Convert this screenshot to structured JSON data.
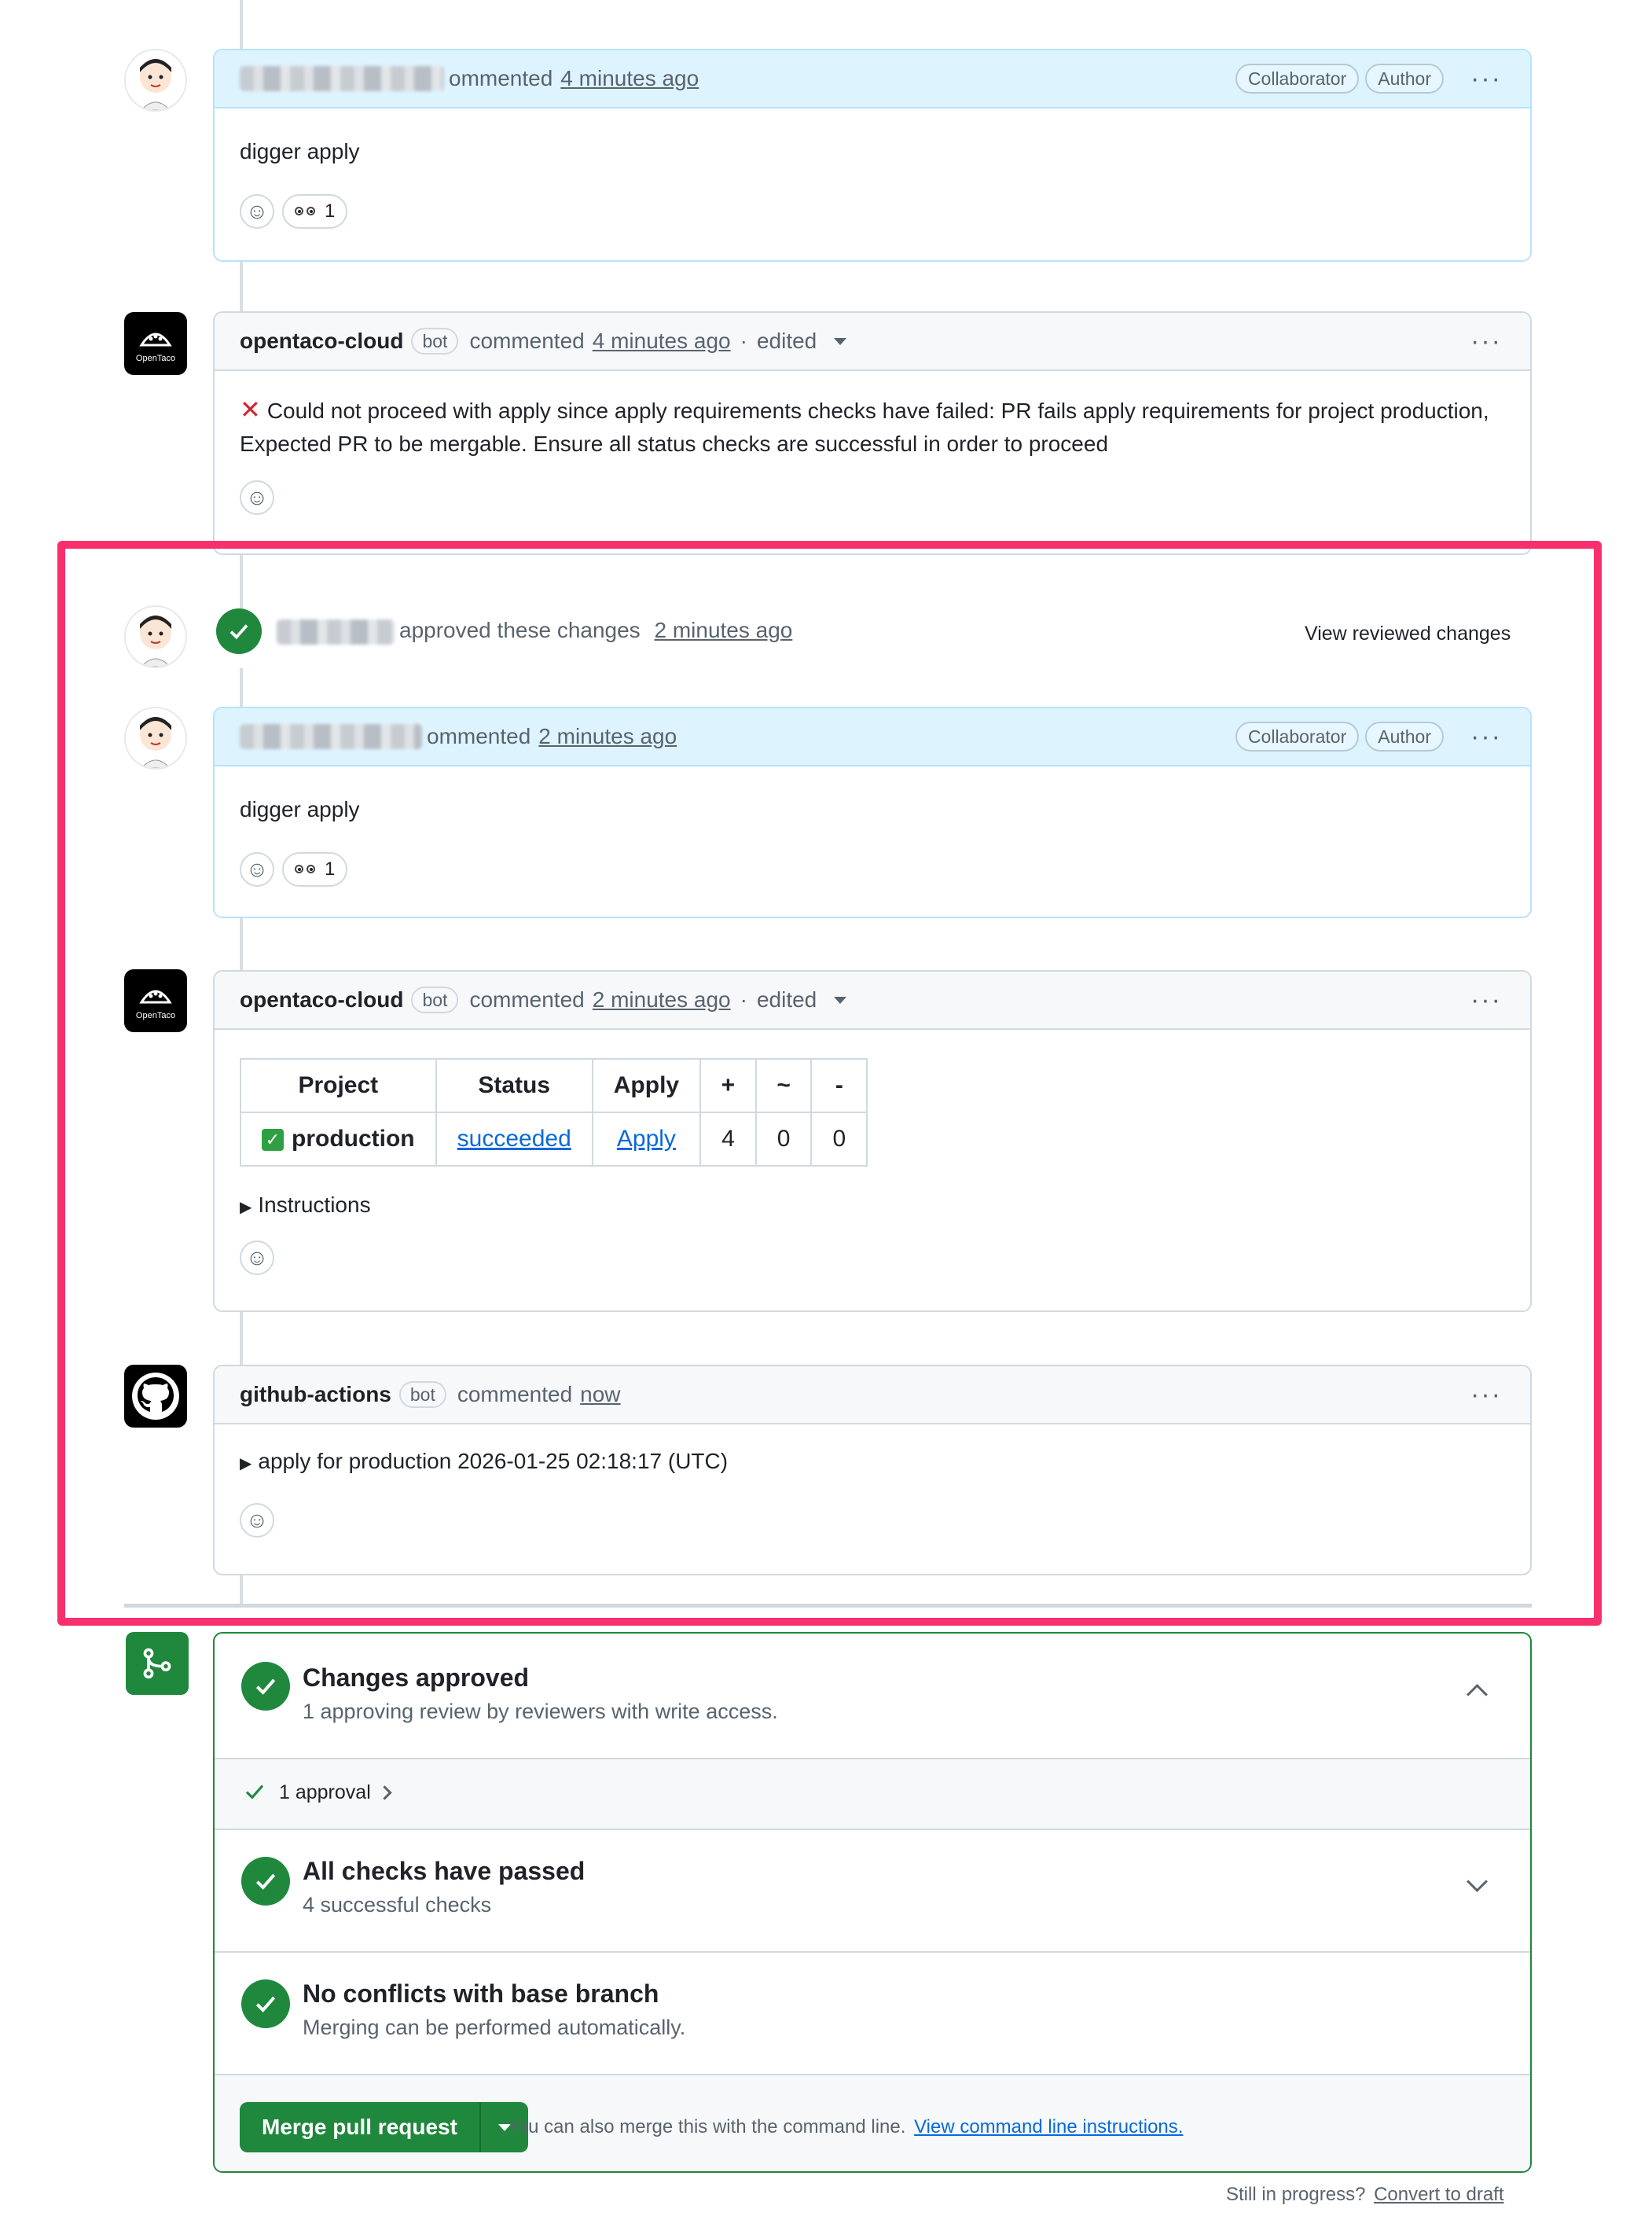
{
  "comments": [
    {
      "author_hidden": true,
      "action": "ommented",
      "time": "4 minutes ago",
      "badges": [
        "Collaborator",
        "Author"
      ],
      "body": "digger apply",
      "reaction_count": "1"
    },
    {
      "author": "opentaco-cloud",
      "bot_label": "bot",
      "action": "commented",
      "time": "4 minutes ago",
      "edited": "edited",
      "body_icon": "red-x-icon",
      "body": "Could not proceed with apply since apply requirements checks have failed: PR fails apply requirements for project production, Expected PR to be mergable. Ensure all status checks are successful in order to proceed"
    },
    {
      "author_hidden": true,
      "action": "ommented",
      "time": "2 minutes ago",
      "badges": [
        "Collaborator",
        "Author"
      ],
      "body": "digger apply",
      "reaction_count": "1"
    },
    {
      "author": "opentaco-cloud",
      "bot_label": "bot",
      "action": "commented",
      "time": "2 minutes ago",
      "edited": "edited",
      "table": {
        "headers": [
          "Project",
          "Status",
          "Apply",
          "+",
          "~",
          "-"
        ],
        "rows": [
          [
            "production",
            "succeeded",
            "Apply",
            "4",
            "0",
            "0"
          ]
        ]
      },
      "details_summary": "Instructions"
    },
    {
      "author": "github-actions",
      "bot_label": "bot",
      "action": "commented",
      "time": "now",
      "details_summary": "apply for production 2026-01-25 02:18:17 (UTC)"
    }
  ],
  "review_event": {
    "text": "approved these changes",
    "time": "2 minutes ago",
    "link": "View reviewed changes"
  },
  "avatars": {
    "opentaco_text": "OpenTaco"
  },
  "merge_box": {
    "approved_title": "Changes approved",
    "approved_sub": "1 approving review by reviewers with write access.",
    "approvals": "1 approval",
    "checks_title": "All checks have passed",
    "checks_sub": "4 successful checks",
    "conflicts_title": "No conflicts with base branch",
    "conflicts_sub": "Merging can be performed automatically.",
    "merge_button": "Merge pull request",
    "cli_text": "You can also merge this with the command line.",
    "cli_link": "View command line instructions."
  },
  "footer": {
    "text": "Still in progress?",
    "link": "Convert to draft"
  },
  "colors": {
    "highlight": "#f72f6d",
    "success": "#1f883d",
    "link": "#0969da",
    "danger": "#d1242f"
  }
}
